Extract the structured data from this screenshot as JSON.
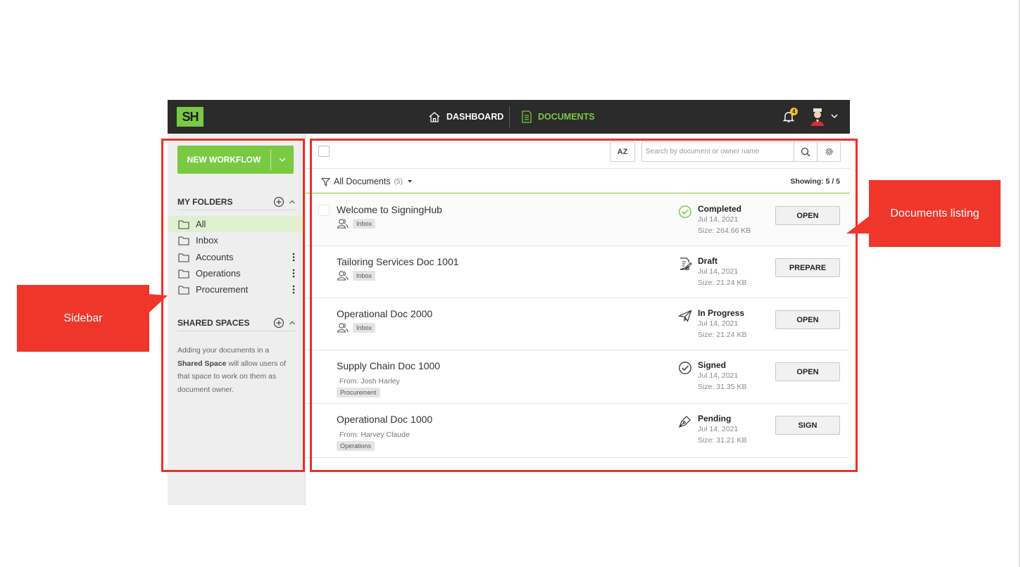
{
  "header": {
    "logo_text": "SH",
    "nav": {
      "dashboard_label": "DASHBOARD",
      "documents_label": "DOCUMENTS"
    },
    "notification_count": "4",
    "icons": [
      "home-icon",
      "document-icon",
      "bell-icon",
      "avatar",
      "chevron-down-icon"
    ]
  },
  "sidebar": {
    "new_workflow_label": "NEW WORKFLOW",
    "my_folders_title": "MY FOLDERS",
    "folders": [
      {
        "label": "All",
        "active": true
      },
      {
        "label": "Inbox"
      },
      {
        "label": "Accounts"
      },
      {
        "label": "Operations"
      },
      {
        "label": "Procurement"
      }
    ],
    "shared_spaces_title": "SHARED SPACES",
    "shared_note": {
      "part1": "Adding your documents in a",
      "bold": "Shared Space",
      "part2": "will allow users of that space to work on them as document owner."
    }
  },
  "toolbar": {
    "sort_label": "AZ",
    "search_placeholder": "Search by document or owner name"
  },
  "filter": {
    "label": "All Documents",
    "count": "(5)",
    "showing": "Showing: 5  /  5"
  },
  "documents": [
    {
      "name": "Welcome to SigningHub",
      "from": "",
      "tag": "Inbox",
      "status": "Completed",
      "date": "Jul 14, 2021",
      "size": "Size: 264.66 KB",
      "action": "OPEN"
    },
    {
      "name": "Tailoring Services Doc 1001",
      "from": "",
      "tag": "Inbox",
      "status": "Draft",
      "date": "Jul 14, 2021",
      "size": "Size: 21.24 KB",
      "action": "PREPARE"
    },
    {
      "name": "Operational Doc 2000",
      "from": "",
      "tag": "Inbox",
      "status": "In Progress",
      "date": "Jul 14, 2021",
      "size": "Size: 21.24 KB",
      "action": "OPEN"
    },
    {
      "name": "Supply Chain Doc 1000",
      "from": "From: Josh Harley",
      "tag": "Procurement",
      "status": "Signed",
      "date": "Jul 14, 2021",
      "size": "Size: 31.35 KB",
      "action": "OPEN"
    },
    {
      "name": "Operational Doc 1000",
      "from": "From: Harvey Claude",
      "tag": "Operations",
      "status": "Pending",
      "date": "Jul 14, 2021",
      "size": "Size: 31.21 KB",
      "action": "SIGN"
    }
  ],
  "annotations": {
    "sidebar_label": "Sidebar",
    "listing_label": "Documents listing",
    "color": "#f0362b"
  },
  "colors": {
    "brand_green": "#7ac943",
    "topbar": "#2b2b2b",
    "annotation_red": "#e8322a"
  }
}
